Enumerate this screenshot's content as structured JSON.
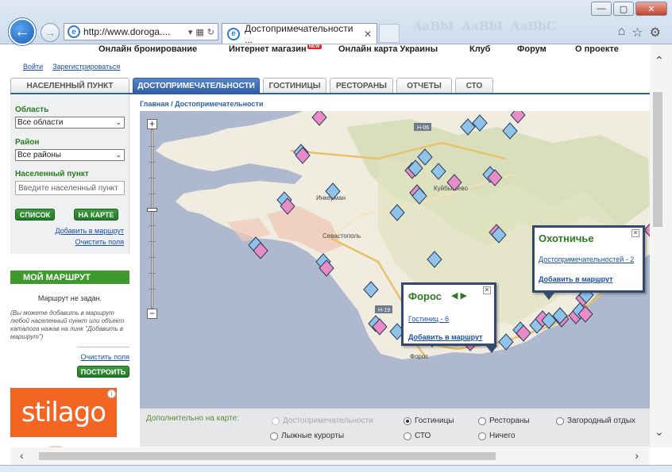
{
  "browser": {
    "address": "http://www.doroga....",
    "tab_title": "Достопримечательности ...",
    "ghost_tabs": [
      "AaBbI",
      "AaBbI",
      "AaBbC"
    ],
    "window_controls": {
      "minimize": "—",
      "maximize": "▢",
      "close": "✕"
    }
  },
  "site_nav": {
    "items": [
      "Онлайн бронирование",
      "Интернет магазин",
      "Онлайн карта Украины",
      "Клуб",
      "Форум",
      "О проекте"
    ],
    "new_badge": "NEW"
  },
  "auth": {
    "login": "Войти",
    "register": "Зарегистрироваться"
  },
  "tabs": [
    "НАСЕЛЕННЫЙ ПУНКТ",
    "ДОСТОПРИМЕЧАТЕЛЬНОСТИ",
    "ГОСТИНИЦЫ",
    "РЕСТОРАНЫ",
    "ОТЧЕТЫ",
    "СТО"
  ],
  "active_tab": "ДОСТОПРИМЕЧАТЕЛЬНОСТИ",
  "breadcrumb": "Главная / Достопримечательности",
  "sidebar": {
    "region_label": "Область",
    "region_value": "Все области",
    "district_label": "Район",
    "district_value": "Все районы",
    "settlement_label": "Населенный пункт",
    "settlement_placeholder": "Введите населенный пункт",
    "list_button": "СПИСОК",
    "map_button": "НА КАРТЕ",
    "add_route": "Добавить в маршрут",
    "clear_fields": "Очистить поля"
  },
  "route": {
    "title": "МОЙ МАРШРУТ",
    "empty": "Маршрут не задан.",
    "hint": "(Вы можете добавить в маршрут любой населенный пункт или объект каталога нажав на линк \"Добавить в маршрут\")",
    "clear": "Очистить поля",
    "build": "ПОСТРОИТЬ"
  },
  "ad": {
    "brand": "stilago",
    "info": "i"
  },
  "map": {
    "labels": [
      "Инкерман",
      "Севастополь",
      "Куйбышево",
      "Форос",
      "Н-06",
      "Н-19"
    ],
    "popup_foros": {
      "title": "Форос",
      "link": "Гостиниц - 6",
      "add": "Добавить в маршрут"
    },
    "popup_okhotnichye": {
      "title": "Охотничье",
      "link": "Достопримечательностей - 2",
      "add": "Добавить в маршрут"
    }
  },
  "options": {
    "label": "Дополнительно на карте:",
    "items": [
      {
        "label": "Достопримечательности",
        "state": "disabled"
      },
      {
        "label": "Гостиницы",
        "state": "selected"
      },
      {
        "label": "Рестораны",
        "state": "off"
      },
      {
        "label": "Загородный отдых",
        "state": "off"
      },
      {
        "label": "Лыжные курорты",
        "state": "off"
      },
      {
        "label": "СТО",
        "state": "off"
      },
      {
        "label": "Ничего",
        "state": "off"
      }
    ]
  },
  "colors": {
    "accent_blue": "#2e5ea8",
    "green": "#2e7a22",
    "marker_pink": "#e98bc6",
    "marker_blue": "#8fc3ea",
    "map_sea": "#aeb8cf"
  }
}
